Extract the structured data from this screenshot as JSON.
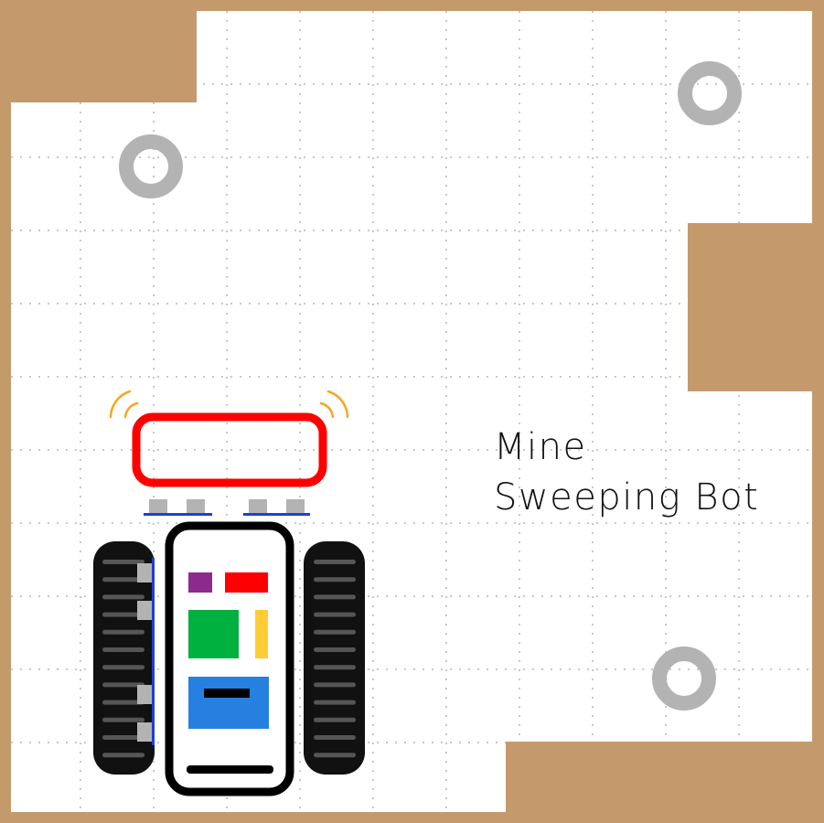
{
  "title": {
    "line1": "Mine",
    "line2": "Sweeping Bot"
  },
  "colors": {
    "wall": "#c49a6c",
    "floor": "#ffffff",
    "grid_dots": "#c8c8c8",
    "mine": "#b3b3b3",
    "detector": "#ff0000",
    "signal_arcs": "#f5a623",
    "sensor": "#b3b3b3",
    "sensor_bar": "#1f3fd6",
    "track": "#111111",
    "tread": "#555555",
    "chassis": "#000000",
    "module_purple": "#8e2a8e",
    "module_red": "#ff0000",
    "module_green": "#00b140",
    "module_yellow": "#ffcc33",
    "module_blue": "#2680e0"
  },
  "mines": [
    {
      "name": "mine-top-left"
    },
    {
      "name": "mine-top-right"
    },
    {
      "name": "mine-bottom-right"
    }
  ],
  "icons": {
    "mine": "landmine-icon",
    "signal": "signal-wave-icon"
  }
}
